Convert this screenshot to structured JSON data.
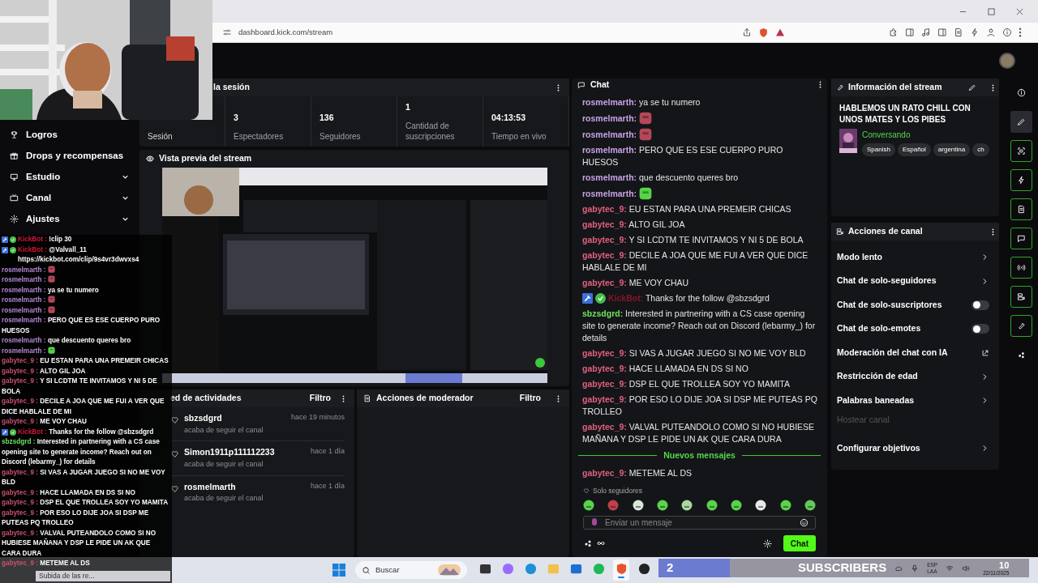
{
  "browser": {
    "url": "dashboard.kick.com/stream"
  },
  "sidebar": {
    "items": [
      {
        "label": "Logros",
        "kind": "link"
      },
      {
        "label": "Drops y recompensas",
        "kind": "link"
      },
      {
        "label": "Estudio",
        "kind": "group",
        "expanded": false
      },
      {
        "label": "Canal",
        "kind": "group",
        "expanded": false
      },
      {
        "label": "Ajustes",
        "kind": "group",
        "expanded": false
      }
    ]
  },
  "session": {
    "title": "la sesión",
    "stats": [
      {
        "label": "Sesión",
        "selected": true
      },
      {
        "value": "3",
        "label": "Espectadores",
        "selected": false
      },
      {
        "value": "136",
        "label": "Seguidores",
        "selected": false
      },
      {
        "value": "1",
        "label": "Cantidad de suscripciones",
        "selected": false
      },
      {
        "value": "04:13:53",
        "label": "Tiempo en vivo",
        "selected": false
      }
    ]
  },
  "preview": {
    "title": "Vista previa del stream",
    "kind": "picture"
  },
  "activity": {
    "title": "ed de actividades",
    "filter": "Filtro",
    "items": [
      {
        "user": "sbzsdgrd",
        "time": "hace 19 minutos",
        "action": "acaba de seguir el canal"
      },
      {
        "user": "Simon1911p111112233",
        "time": "hace 1 día",
        "action": "acaba de seguir el canal"
      },
      {
        "user": "rosmelmarth",
        "time": "hace 1 día",
        "action": "acaba de seguir el canal"
      }
    ]
  },
  "moderator": {
    "title": "Acciones de moderador",
    "filter": "Filtro"
  },
  "chat": {
    "title": "Chat",
    "messages": [
      {
        "user": "rosmelmarth:",
        "color": "#c7a3e6",
        "kind": "text",
        "text": "ya se tu numero"
      },
      {
        "user": "rosmelmarth:",
        "color": "#c7a3e6",
        "kind": "emote"
      },
      {
        "user": "rosmelmarth:",
        "color": "#c7a3e6",
        "kind": "emote"
      },
      {
        "user": "rosmelmarth:",
        "color": "#c7a3e6",
        "kind": "text",
        "text": "PERO QUE ES ESE CUERPO PURO HUESOS"
      },
      {
        "user": "rosmelmarth:",
        "color": "#c7a3e6",
        "kind": "text",
        "text": "que descuento queres bro"
      },
      {
        "user": "rosmelmarth:",
        "color": "#c7a3e6",
        "kind": "blob"
      },
      {
        "user": "gabytec_9:",
        "color": "#e0607f",
        "kind": "text",
        "text": "EU ESTAN PARA UNA PREMEIR CHICAS"
      },
      {
        "user": "gabytec_9:",
        "color": "#e0607f",
        "kind": "text",
        "text": "ALTO GIL JOA"
      },
      {
        "user": "gabytec_9:",
        "color": "#e0607f",
        "kind": "text",
        "text": "Y SI LCDTM TE INVITAMOS Y NI 5 DE BOLA"
      },
      {
        "user": "gabytec_9:",
        "color": "#e0607f",
        "kind": "text",
        "text": "DECILE A JOA QUE ME FUI A VER QUE DICE HABLALE DE MI"
      },
      {
        "user": "gabytec_9:",
        "color": "#e0607f",
        "kind": "text",
        "text": "ME VOY CHAU"
      },
      {
        "user": "KickBot:",
        "color": "#8a1428",
        "kind": "bot",
        "text": "Thanks for the follow @sbzsdgrd"
      },
      {
        "user": "sbzsdgrd:",
        "color": "#6fe35c",
        "kind": "text",
        "text": "Interested in partnering with a CS case opening site to generate income? Reach out on Discord (lebarmy_) for details"
      },
      {
        "user": "gabytec_9:",
        "color": "#e0607f",
        "kind": "text",
        "text": "SI VAS A JUGAR JUEGO SI NO ME VOY BLD"
      },
      {
        "user": "gabytec_9:",
        "color": "#e0607f",
        "kind": "text",
        "text": "HACE LLAMADA EN DS SI NO"
      },
      {
        "user": "gabytec_9:",
        "color": "#e0607f",
        "kind": "text",
        "text": "DSP EL QUE TROLLEA SOY YO MAMITA"
      },
      {
        "user": "gabytec_9:",
        "color": "#e0607f",
        "kind": "text",
        "text": "POR ESO LO DIJE JOA SI DSP ME PUTEAS PQ TROLLEO"
      },
      {
        "user": "gabytec_9:",
        "color": "#e0607f",
        "kind": "text",
        "text": "VALVAL PUTEANDOLO COMO SI NO HUBIESE MAÑANA Y DSP LE PIDE UN AK QUE CARA DURA"
      }
    ],
    "divider": "Nuevos mensajes",
    "new_messages": [
      {
        "user": "gabytec_9:",
        "color": "#e0607f",
        "kind": "text",
        "text": "METEME AL DS"
      }
    ],
    "follower_mode": "Solo seguidores",
    "quick_emotes": [
      {
        "color": "#58d34a"
      },
      {
        "color": "#c0404a"
      },
      {
        "color": "#d8e8d8"
      },
      {
        "color": "#58d34a"
      },
      {
        "color": "#a8d8a0"
      },
      {
        "color": "#58d34a"
      },
      {
        "color": "#58d34a"
      },
      {
        "color": "#e8e8e8"
      },
      {
        "color": "#58d34a"
      },
      {
        "color": "#62c85a"
      }
    ],
    "input": {
      "placeholder": "Enviar un mensaje"
    },
    "send": "Chat"
  },
  "info": {
    "title": "Información del stream",
    "stream_title": "HABLEMOS UN RATO CHILL CON UNOS MATES Y LOS PIBES",
    "category": "Conversando",
    "tags": [
      "Spanish",
      "Español",
      "argentina",
      "ch"
    ]
  },
  "actions": {
    "title": "Acciones de canal",
    "items": [
      {
        "label": "Modo lento",
        "kind": "arrow"
      },
      {
        "label": "Chat de solo-seguidores",
        "kind": "arrow"
      },
      {
        "label": "Chat de solo-suscriptores",
        "kind": "toggle",
        "on": false
      },
      {
        "label": "Chat de solo-emotes",
        "kind": "toggle",
        "on": false
      },
      {
        "label": "Moderación del chat con IA",
        "kind": "external"
      },
      {
        "label": "Restricción de edad",
        "kind": "arrow"
      },
      {
        "label": "Palabras baneadas",
        "kind": "arrow"
      },
      {
        "label": "Hostear canal",
        "kind": "disabled"
      },
      {
        "label": "Configurar objetivos",
        "kind": "arrow"
      }
    ]
  },
  "rail": {
    "items": [
      {
        "selected": false,
        "pinned": false
      },
      {
        "selected": true,
        "pinned": false
      },
      {
        "selected": false,
        "pinned": true
      },
      {
        "selected": false,
        "pinned": true
      },
      {
        "selected": false,
        "pinned": true
      },
      {
        "selected": false,
        "pinned": true
      },
      {
        "selected": false,
        "pinned": true
      },
      {
        "selected": false,
        "pinned": true
      },
      {
        "selected": false,
        "pinned": true
      },
      {
        "selected": false,
        "pinned": false
      }
    ]
  },
  "overlay": {
    "chat": [
      {
        "user": "KickBot :",
        "color": "#d3163a",
        "kind": "bot",
        "text": "!clip 30"
      },
      {
        "user": "KickBot :",
        "color": "#d3163a",
        "kind": "bot",
        "text": "@Valvall_11 https://kickbot.com/clip/9s4vr3dwvxs4"
      },
      {
        "user": "rosmelmarth :",
        "color": "#b58ad6",
        "kind": "emote"
      },
      {
        "user": "rosmelmarth :",
        "color": "#b58ad6",
        "kind": "emote"
      },
      {
        "user": "rosmelmarth :",
        "color": "#b58ad6",
        "kind": "text",
        "text": "ya se tu numero"
      },
      {
        "user": "rosmelmarth :",
        "color": "#b58ad6",
        "kind": "emote"
      },
      {
        "user": "rosmelmarth :",
        "color": "#b58ad6",
        "kind": "emote"
      },
      {
        "user": "rosmelmarth :",
        "color": "#b58ad6",
        "kind": "text",
        "text": "PERO QUE ES ESE CUERPO PURO HUESOS"
      },
      {
        "user": "rosmelmarth :",
        "color": "#b58ad6",
        "kind": "text",
        "text": "que descuento queres bro"
      },
      {
        "user": "rosmelmarth :",
        "color": "#b58ad6",
        "kind": "blob"
      },
      {
        "user": "gabytec_9 :",
        "color": "#c9506e",
        "kind": "text",
        "text": "EU ESTAN PARA UNA PREMEIR CHICAS"
      },
      {
        "user": "gabytec_9 :",
        "color": "#c9506e",
        "kind": "text",
        "text": "ALTO GIL JOA"
      },
      {
        "user": "gabytec_9 :",
        "color": "#c9506e",
        "kind": "text",
        "text": "Y SI LCDTM TE INVITAMOS Y NI 5 DE BOLA"
      },
      {
        "user": "gabytec_9 :",
        "color": "#c9506e",
        "kind": "text",
        "text": "DECILE A JOA QUE ME FUI A VER QUE DICE HABLALE DE MI"
      },
      {
        "user": "gabytec_9 :",
        "color": "#c9506e",
        "kind": "text",
        "text": "ME VOY CHAU"
      },
      {
        "user": "KickBot :",
        "color": "#d3163a",
        "kind": "bot",
        "text": "Thanks for the follow @sbzsdgrd"
      },
      {
        "user": "sbzsdgrd :",
        "color": "#6fe35c",
        "kind": "text",
        "text": "Interested in partnering with a CS case opening site to generate income? Reach out on Discord (lebarmy_) for details"
      },
      {
        "user": "gabytec_9 :",
        "color": "#c9506e",
        "kind": "text",
        "text": "SI VAS A JUGAR JUEGO SI NO ME VOY BLD"
      },
      {
        "user": "gabytec_9 :",
        "color": "#c9506e",
        "kind": "text",
        "text": "HACE LLAMADA EN DS SI NO"
      },
      {
        "user": "gabytec_9 :",
        "color": "#c9506e",
        "kind": "text",
        "text": "DSP EL QUE TROLLEA SOY YO MAMITA"
      },
      {
        "user": "gabytec_9 :",
        "color": "#c9506e",
        "kind": "text",
        "text": "POR ESO LO DIJE JOA SI DSP ME PUTEAS PQ TROLLEO"
      },
      {
        "user": "gabytec_9 :",
        "color": "#c9506e",
        "kind": "text",
        "text": "VALVAL PUTEANDOLO COMO SI NO HUBIESE MAÑANA Y DSP LE PIDE UN AK QUE CARA DURA"
      },
      {
        "user": "gabytec_9 :",
        "color": "#c9506e",
        "kind": "text",
        "text": "METEME AL DS"
      }
    ],
    "toast": "Subida de las re...",
    "subscribers": {
      "count": "2",
      "label": "SUBSCRIBERS"
    }
  },
  "taskbar": {
    "search": "Buscar",
    "apps": [
      {
        "selected": false
      },
      {
        "selected": false
      },
      {
        "selected": false
      },
      {
        "selected": false
      },
      {
        "selected": false
      },
      {
        "selected": false
      },
      {
        "selected": true
      },
      {
        "selected": false
      }
    ],
    "lang": "ESP",
    "layout": "LAA",
    "time": "10",
    "date": "22/11/2025"
  }
}
